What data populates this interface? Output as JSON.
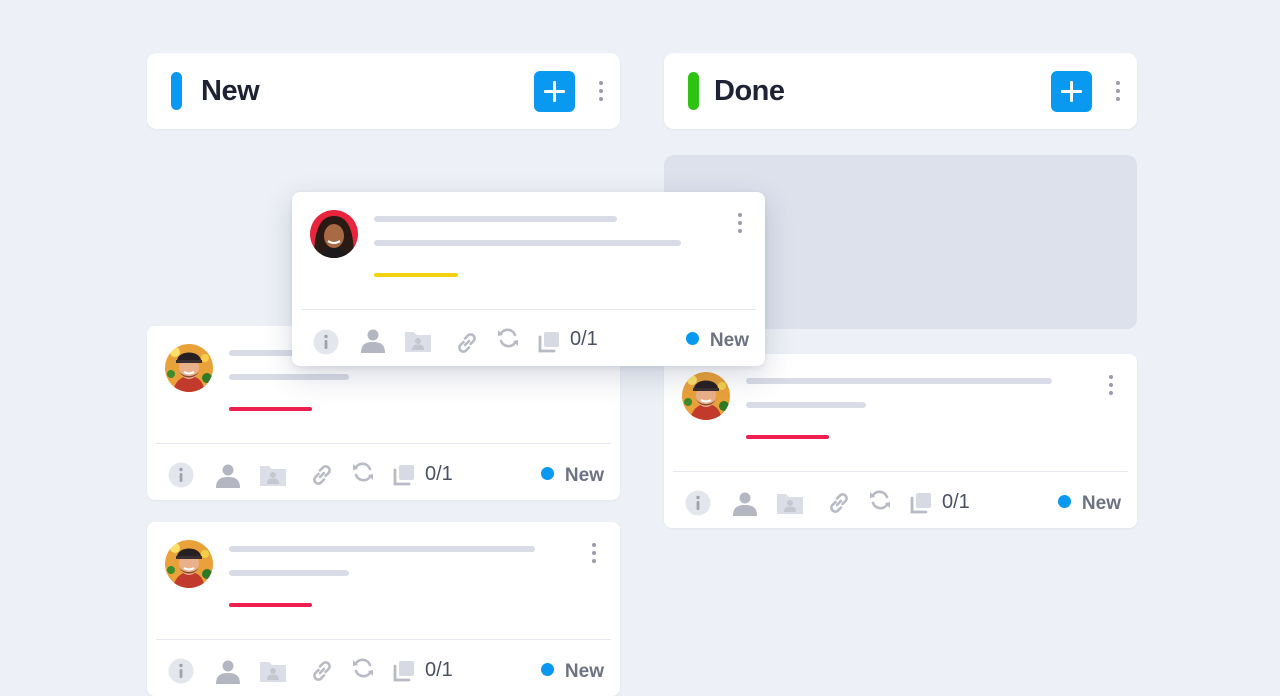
{
  "columns": [
    {
      "title": "New",
      "bar_color": "#0a99f1"
    },
    {
      "title": "Done",
      "bar_color": "#2fc213"
    }
  ],
  "cards": {
    "floating": {
      "counter": "0/1",
      "status": "New",
      "accent_color": "#f2d212",
      "avatar": "woman-avatar"
    },
    "new_1": {
      "counter": "0/1",
      "status": "New",
      "accent_color": "#ee1e4f",
      "avatar": "man-avatar"
    },
    "new_2": {
      "counter": "0/1",
      "status": "New",
      "accent_color": "#ee1e4f",
      "avatar": "man-avatar"
    },
    "done_1": {
      "counter": "0/1",
      "status": "New",
      "accent_color": "#ee1e4f",
      "avatar": "man-avatar"
    }
  },
  "colors": {
    "background": "#edf0f6",
    "accent_blue": "#0a99f1",
    "placeholder": "#dde1ec"
  },
  "icons": [
    "info-icon",
    "assignee-icon",
    "folder-icon",
    "link-icon",
    "recurring-icon",
    "subtasks-icon"
  ]
}
